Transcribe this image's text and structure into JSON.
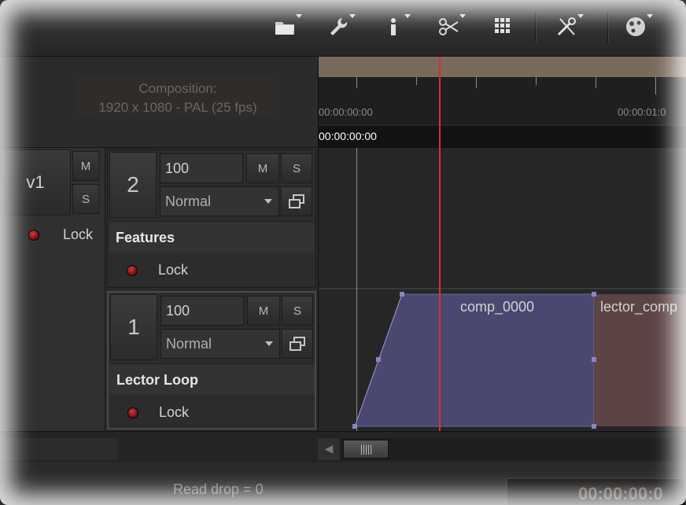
{
  "toolbar": {
    "icons": [
      "folder-icon",
      "wrench-icon",
      "info-icon",
      "scissors-icon",
      "grid-icon",
      "tools-icon",
      "settings-icon"
    ]
  },
  "composition": {
    "label": "Composition:",
    "format": "1920 x 1080 - PAL (25 fps)"
  },
  "ruler": {
    "start_label": "00:00:00:00",
    "end_label": "00:00:01:0",
    "current_time": "00:00:00:00"
  },
  "video_track_group": {
    "label": "v1",
    "mute_label": "M",
    "solo_label": "S",
    "lock_label": "Lock"
  },
  "tracks": [
    {
      "number": "2",
      "opacity": "100",
      "blend_mode": "Normal",
      "mute_label": "M",
      "solo_label": "S",
      "name": "Features",
      "lock_label": "Lock"
    },
    {
      "number": "1",
      "opacity": "100",
      "blend_mode": "Normal",
      "mute_label": "M",
      "solo_label": "S",
      "name": "Lector Loop",
      "lock_label": "Lock"
    }
  ],
  "clips": [
    {
      "name": "comp_0000",
      "color": "#4a4870"
    },
    {
      "name": "lector_comp",
      "color": "#5c4445"
    }
  ],
  "status": {
    "read_drop": "Read drop = 0",
    "timecode": "00:00:00:0"
  },
  "colors": {
    "playhead": "#d83030",
    "ruler_top": "#7a6a5c",
    "clip_primary": "#4a4870",
    "clip_secondary": "#5c4445"
  }
}
